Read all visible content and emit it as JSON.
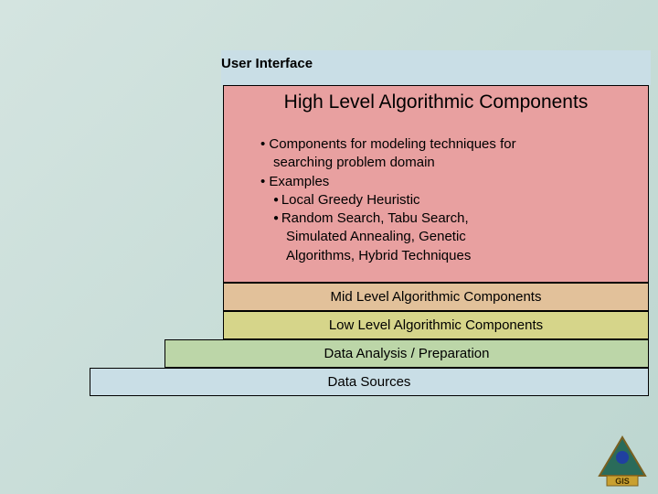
{
  "layers": {
    "ui": "User Interface",
    "hlac": {
      "title": "High Level Algorithmic Components",
      "b1": "Components for modeling techniques for",
      "b1_cont": "searching problem domain",
      "b2": "Examples",
      "b2a": "Local Greedy Heuristic",
      "b2b": "Random Search, Tabu Search,",
      "b2b_cont1": "Simulated Annealing, Genetic",
      "b2b_cont2": "Algorithms, Hybrid Techniques"
    },
    "mlac": "Mid Level Algorithmic Components",
    "llac": "Low Level Algorithmic Components",
    "dap": "Data Analysis / Preparation",
    "ds": "Data Sources"
  },
  "logo": {
    "label": "GIS"
  }
}
